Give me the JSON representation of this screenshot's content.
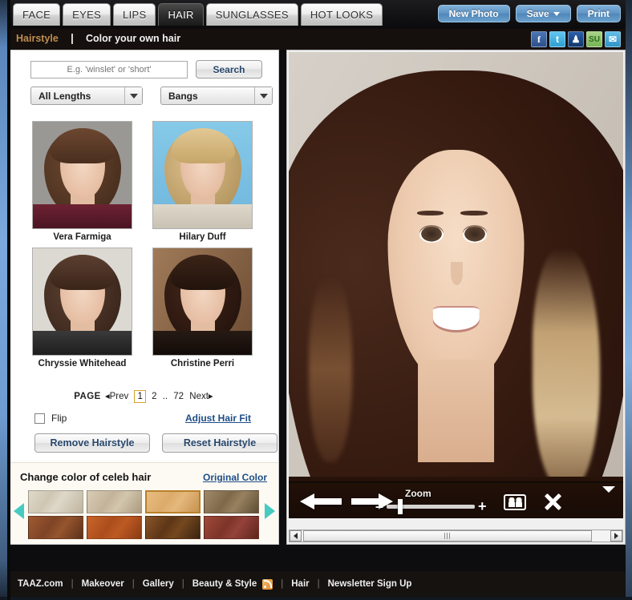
{
  "header": {
    "tabs": [
      {
        "label": "FACE",
        "active": false
      },
      {
        "label": "EYES",
        "active": false
      },
      {
        "label": "LIPS",
        "active": false
      },
      {
        "label": "HAIR",
        "active": true
      },
      {
        "label": "SUNGLASSES",
        "active": false
      },
      {
        "label": "HOT LOOKS",
        "active": false
      }
    ],
    "buttons": {
      "new_photo": "New Photo",
      "save": "Save",
      "print": "Print"
    }
  },
  "subheader": {
    "breadcrumb": "Hairstyle",
    "separator": "|",
    "title": "Color your own hair",
    "social": [
      {
        "name": "facebook-icon",
        "glyph": "f"
      },
      {
        "name": "twitter-icon",
        "glyph": "t"
      },
      {
        "name": "myspace-icon",
        "glyph": "♟"
      },
      {
        "name": "stumbleupon-icon",
        "glyph": "SU"
      },
      {
        "name": "email-icon",
        "glyph": "✉"
      }
    ]
  },
  "sidebar": {
    "search": {
      "placeholder": "E.g. 'winslet' or 'short'",
      "value": "",
      "button_label": "Search"
    },
    "filters": [
      {
        "name": "length-filter",
        "value": "All Lengths"
      },
      {
        "name": "bangs-filter",
        "value": "Bangs"
      }
    ],
    "thumbnails": [
      {
        "label": "Vera Farmiga",
        "bg": "#9a9894",
        "hair": "#5a3b28",
        "hair_top": "#6b4730",
        "body": "#5a2030"
      },
      {
        "label": "Hilary Duff",
        "bg": "#7ec2e4",
        "hair": "#c7a36a",
        "hair_top": "#d9bb84",
        "body": "#d8d2c6"
      },
      {
        "label": "Chryssie Whitehead",
        "bg": "#d9d6d0",
        "hair": "#4a3327",
        "hair_top": "#5c4031",
        "body": "#2b2b2b"
      },
      {
        "label": "Christine Perri",
        "bg": "#8e6b4e",
        "hair": "#2e1a12",
        "hair_top": "#3c2418",
        "body": "#1d1412"
      }
    ],
    "pagination": {
      "label": "PAGE",
      "prev": "◂Prev",
      "pages": [
        "1",
        "2"
      ],
      "ellipsis": "..",
      "last": "72",
      "next": "Next▸",
      "current": "1"
    },
    "flip": {
      "label": "Flip",
      "checked": false
    },
    "adjust_link": "Adjust Hair Fit",
    "actions": {
      "remove": "Remove Hairstyle",
      "reset": "Reset Hairstyle"
    },
    "color_section": {
      "title": "Change color of celeb hair",
      "original_link": "Original Color",
      "prev_arrow": "prev-colors-arrow",
      "next_arrow": "next-colors-arrow",
      "swatches_row1": [
        "#cfc6b2",
        "#c3b39a",
        "#dbab6b",
        "#8d7458"
      ],
      "swatches_row2": [
        "#8e4a2a",
        "#b4541f",
        "#6b3e1c",
        "#8d3c2e"
      ],
      "selected_index": 2
    }
  },
  "photo_tools": {
    "back_label": "back-arrow",
    "forward_label": "forward-arrow",
    "zoom_label": "Zoom",
    "zoom_minus": "–",
    "zoom_plus": "+",
    "zoom_value": 13,
    "compare_label": "compare-faces-icon",
    "close_label": "close-icon",
    "dropdown_label": "chevron-down-icon"
  },
  "footer": {
    "links": [
      "TAAZ.com",
      "Makeover",
      "Gallery",
      "Beauty & Style",
      "Hair",
      "Newsletter Sign Up"
    ],
    "separator": "|",
    "rss_icon": "rss-icon"
  }
}
